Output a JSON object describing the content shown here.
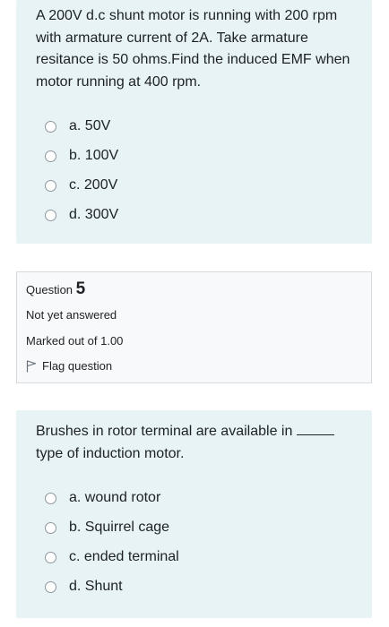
{
  "question4": {
    "text": "A 200V d.c shunt motor is running with 200 rpm with armature current of 2A. Take armature resitance is 50 ohms.Find the induced EMF when motor running at 400 rpm.",
    "options": [
      "a. 50V",
      "b. 100V",
      "c. 200V",
      "d. 300V"
    ]
  },
  "question5_info": {
    "question_label": "Question",
    "question_number": "5",
    "status": "Not yet answered",
    "marks": "Marked out of 1.00",
    "flag_label": "Flag question"
  },
  "question5": {
    "text_before": "Brushes in rotor terminal are available in",
    "text_after": "type of induction motor.",
    "options": [
      "a. wound rotor",
      "b. Squirrel cage",
      "c. ended terminal",
      "d. Shunt"
    ]
  },
  "colors": {
    "question_bg": "#e7f3f5",
    "info_bg": "#f8f9fa",
    "info_border": "#d8dbde",
    "radio_border": "#8f959e",
    "text": "#1d2125"
  },
  "icons": {
    "radio": "radio-unselected-icon",
    "flag": "flag-outline-icon"
  }
}
